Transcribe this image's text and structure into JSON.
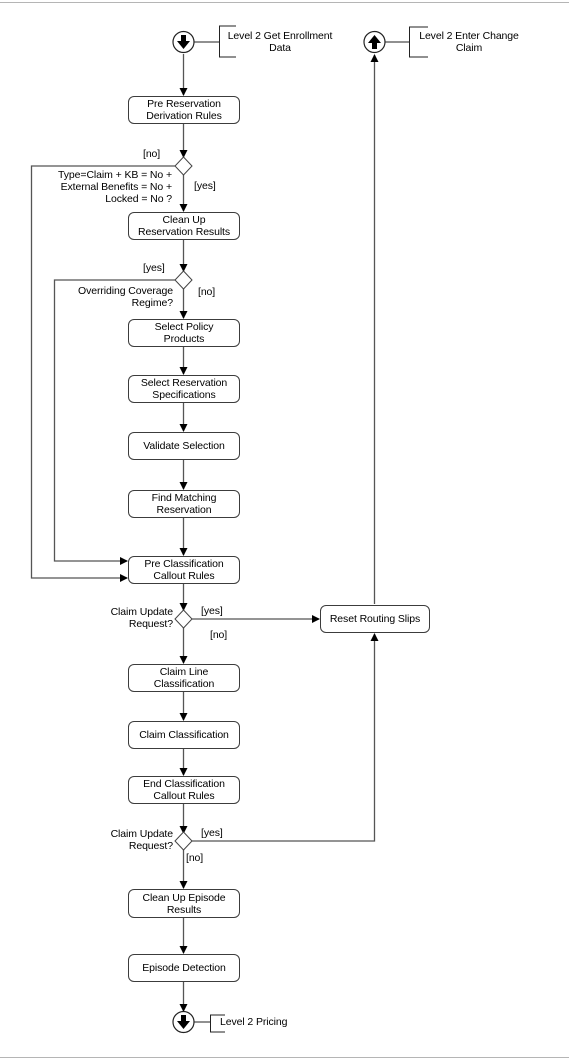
{
  "diagram": {
    "type": "activity-flow",
    "start": {
      "label": "Level 2 Get Enrollment\nData",
      "icon": "arrow-down-circle-icon"
    },
    "exit": {
      "label": "Level 2 Enter Change\nClaim",
      "icon": "arrow-up-circle-icon"
    },
    "end": {
      "label": "Level 2 Pricing",
      "icon": "arrow-down-circle-icon"
    },
    "nodes": {
      "pre_reservation": "Pre Reservation\nDerivation Rules",
      "clean_up_reservation": "Clean Up\nReservation Results",
      "select_policy": "Select Policy\nProducts",
      "select_reservation_specs": "Select Reservation\nSpecifications",
      "validate_selection": "Validate Selection",
      "find_matching": "Find Matching\nReservation",
      "pre_classification": "Pre Classification\nCallout Rules",
      "reset_routing": "Reset Routing Slips",
      "claim_line_classification": "Claim Line\nClassification",
      "claim_classification": "Claim Classification",
      "end_classification": "End Classification\nCallout Rules",
      "clean_up_episode": "Clean Up Episode\nResults",
      "episode_detection": "Episode Detection"
    },
    "decisions": {
      "d1": {
        "question": "Type=Claim + KB = No +\nExternal Benefits = No +\nLocked = No ?",
        "no": "[no]",
        "yes": "[yes]"
      },
      "d2": {
        "question": "Overriding Coverage\nRegime?",
        "yes": "[yes]",
        "no": "[no]"
      },
      "d3": {
        "question": "Claim Update\nRequest?",
        "yes": "[yes]",
        "no": "[no]"
      },
      "d4": {
        "question": "Claim Update\nRequest?",
        "yes": "[yes]",
        "no": "[no]"
      }
    }
  }
}
